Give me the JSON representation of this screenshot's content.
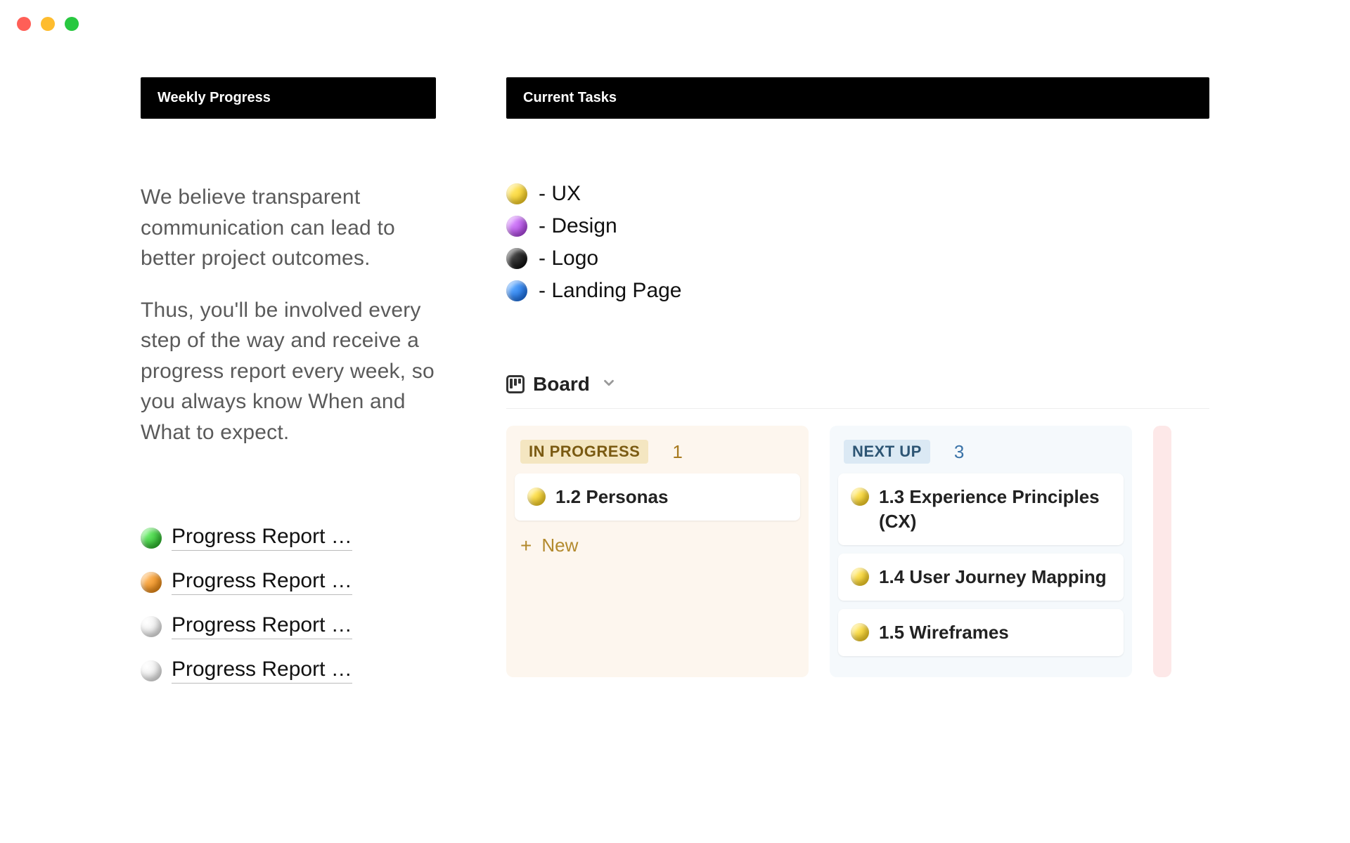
{
  "window": {
    "traffic_lights": [
      "close",
      "minimize",
      "zoom"
    ]
  },
  "left": {
    "header": "Weekly Progress",
    "intro_p1": "We believe transparent communication can lead to better project outcomes.",
    "intro_p2": "Thus, you'll be involved every step of the way and receive a progress report every week, so you always know When and What to expect.",
    "reports": [
      {
        "color": "green",
        "label": "Progress Report …"
      },
      {
        "color": "orange",
        "label": "Progress Report …"
      },
      {
        "color": "white",
        "label": "Progress Report …"
      },
      {
        "color": "white",
        "label": "Progress Report …"
      }
    ]
  },
  "right": {
    "header": "Current Tasks",
    "legend": [
      {
        "color": "yellow",
        "label": "- UX"
      },
      {
        "color": "purple",
        "label": "- Design"
      },
      {
        "color": "black",
        "label": "- Logo"
      },
      {
        "color": "blue",
        "label": "- Landing Page"
      }
    ],
    "board": {
      "view_label": "Board",
      "columns": [
        {
          "key": "in_progress",
          "tag": "IN PROGRESS",
          "count": 1,
          "tag_style": "inprogress",
          "cards": [
            {
              "color": "yellow",
              "title": "1.2 Personas"
            }
          ],
          "new_label": "New"
        },
        {
          "key": "next_up",
          "tag": "NEXT UP",
          "count": 3,
          "tag_style": "nextup",
          "cards": [
            {
              "color": "yellow",
              "title": "1.3 Experience Principles (CX)"
            },
            {
              "color": "yellow",
              "title": "1.4 User Journey Mapping"
            },
            {
              "color": "yellow",
              "title": "1.5 Wireframes"
            }
          ]
        }
      ]
    }
  }
}
